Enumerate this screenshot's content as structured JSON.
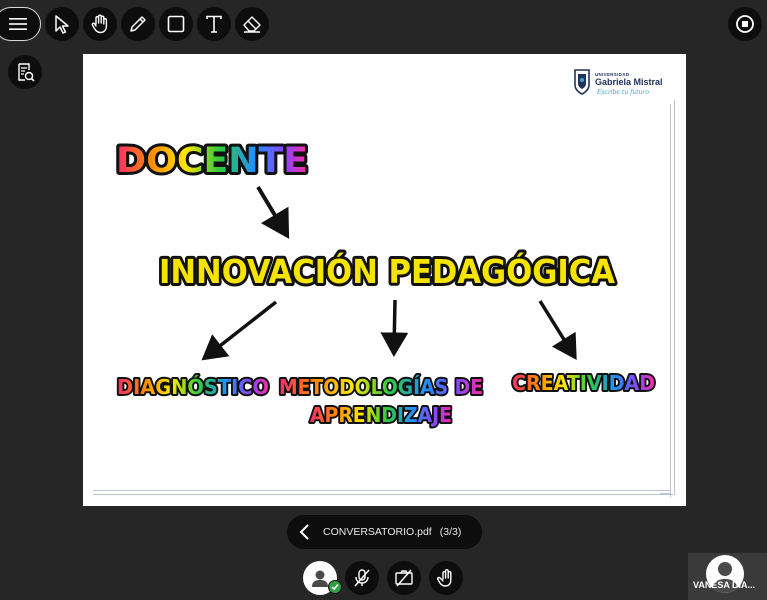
{
  "toolbar": {
    "tools": [
      {
        "name": "menu",
        "icon": "hamburger-icon"
      },
      {
        "name": "select",
        "icon": "arrow-pointer-icon"
      },
      {
        "name": "pan",
        "icon": "hand-icon"
      },
      {
        "name": "pen",
        "icon": "pencil-icon"
      },
      {
        "name": "shape",
        "icon": "square-icon"
      },
      {
        "name": "text",
        "icon": "text-icon"
      },
      {
        "name": "eraser",
        "icon": "eraser-icon"
      }
    ],
    "stop_icon": "stop-icon",
    "side_icon": "zoom-document-icon"
  },
  "slide": {
    "logo": {
      "small": "UNIVERSIDAD",
      "main": "Gabriela Mistral",
      "tag": "Escribe tu futuro"
    },
    "title": "DOCENTE",
    "center": "INNOVACIÓN PEDAGÓGICA",
    "branches": [
      "DIAGNÓSTICO",
      "METODOLOGÍAS DE",
      "APRENDIZAJE",
      "CREATIVIDAD"
    ]
  },
  "pager": {
    "file": "CONVERSATORIO.pdf",
    "page": "(3/3)"
  },
  "controls": [
    {
      "name": "avatar-status",
      "icon": "user-icon",
      "status": "check-icon"
    },
    {
      "name": "microphone",
      "icon": "mic-off-icon"
    },
    {
      "name": "camera",
      "icon": "camera-off-icon"
    },
    {
      "name": "raise-hand",
      "icon": "hand-raise-icon"
    }
  ],
  "participant": {
    "name": "VANESA DIA..."
  },
  "colors": {
    "background": "#262626",
    "button": "#0d0d0d",
    "accent_green": "#2ea043",
    "center_text": "#f5e300"
  }
}
